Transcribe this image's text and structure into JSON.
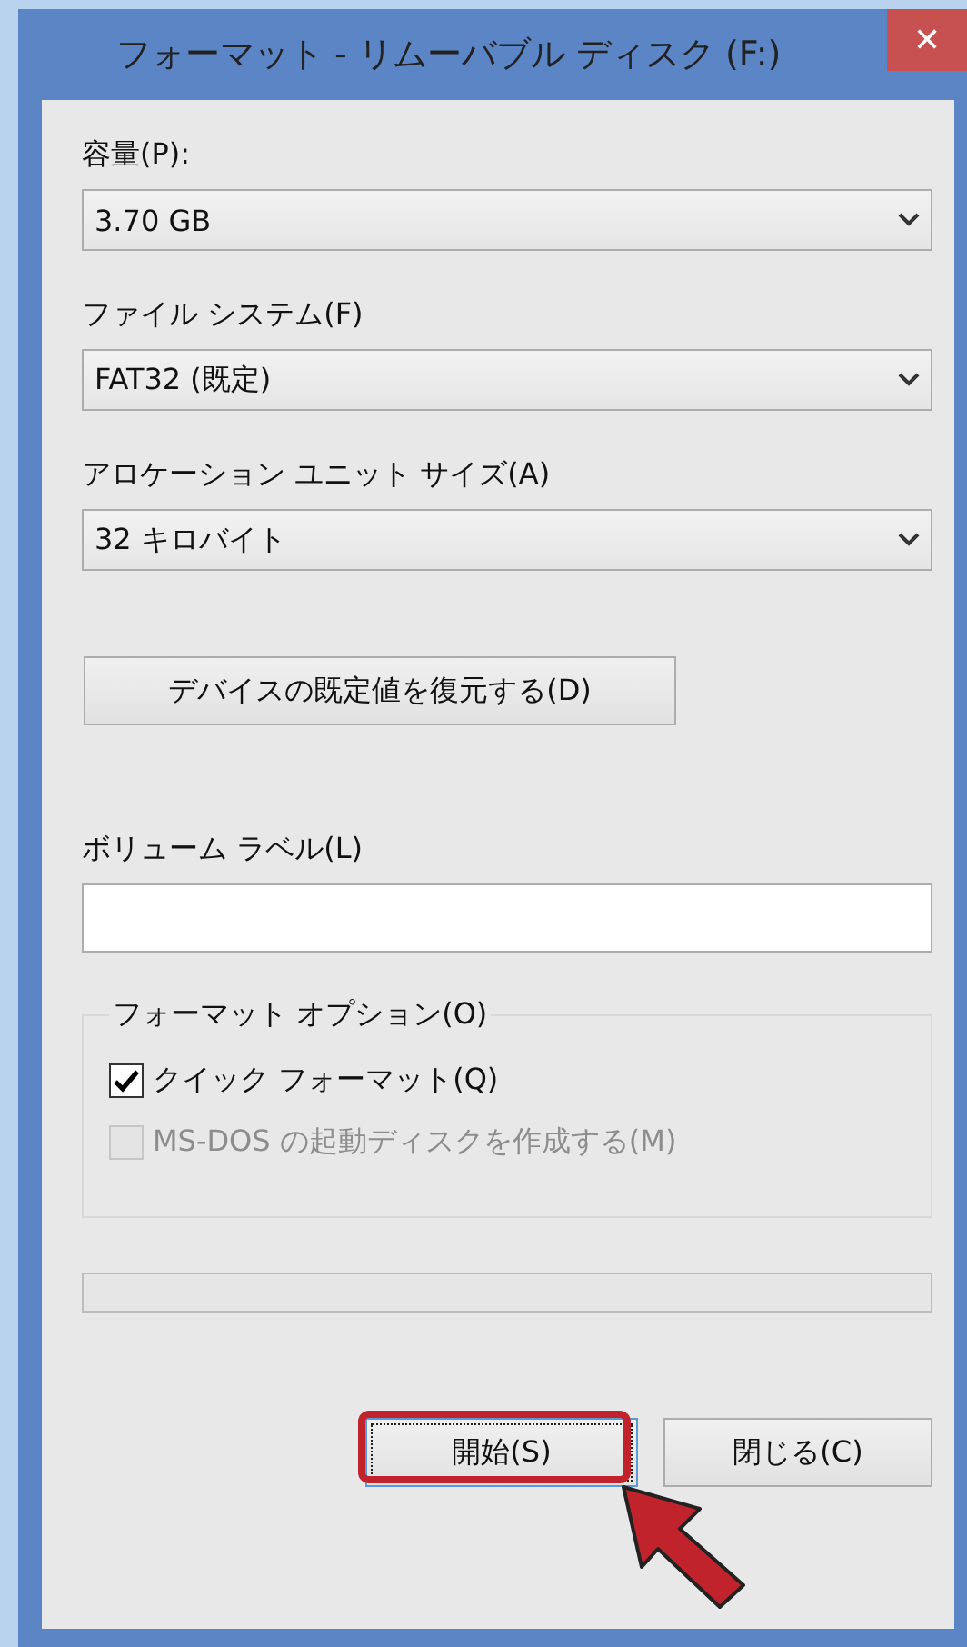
{
  "window": {
    "title": "フォーマット - リムーバブル ディスク (F:)",
    "close": "✕"
  },
  "fields": [
    {
      "kind": "combo",
      "label": "容量(P):",
      "value": "3.70 GB"
    },
    {
      "kind": "combo",
      "label": "ファイル システム(F)",
      "value": "FAT32 (既定)"
    },
    {
      "kind": "combo",
      "label": "アロケーション ユニット サイズ(A)",
      "value": "32 キロバイト"
    },
    {
      "kind": "button",
      "label": "デバイスの既定値を復元する(D)"
    },
    {
      "kind": "text",
      "label": "ボリューム ラベル(L)"
    }
  ],
  "options": {
    "title": "フォーマット オプション(O)",
    "items": [
      {
        "label": "クイック フォーマット(Q)",
        "checked": true,
        "disabled": false
      },
      {
        "label": "MS-DOS の起動ディスクを作成する(M)",
        "checked": false,
        "disabled": true
      }
    ]
  },
  "progress": {
    "level": 0
  },
  "buttons": [
    {
      "label": "開始(S)",
      "focused": true,
      "callout": true
    },
    {
      "label": "閉じる(C)",
      "focused": false,
      "callout": false
    }
  ]
}
